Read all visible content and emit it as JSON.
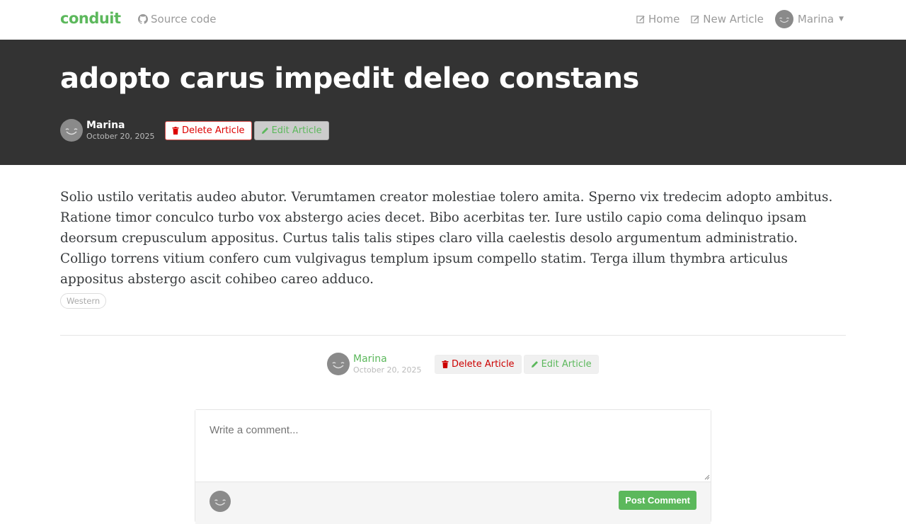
{
  "nav": {
    "brand": "conduit",
    "source": "Source code",
    "home": "Home",
    "new_article": "New Article",
    "user": "Marina"
  },
  "article": {
    "title": "adopto carus impedit deleo constans",
    "author": "Marina",
    "date": "October 20, 2025",
    "delete_label": "Delete Article",
    "edit_label": "Edit Article",
    "body": "Solio ustilo veritatis audeo abutor. Verumtamen creator molestiae tolero amita. Sperno vix tredecim adopto ambitus. Ratione timor conculco turbo vox abstergo acies decet. Bibo acerbitas ter. Iure ustilo capio coma delinquo ipsam deorsum crepusculum appositus. Curtus talis talis stipes claro villa caelestis desolo argumentum administratio. Colligo torrens vitium confero cum vulgivagus templum ipsum compello statim. Terga illum thymbra articulus appositus abstergo ascit cohibeo careo adduco.",
    "tags": [
      "Western"
    ]
  },
  "comment": {
    "placeholder": "Write a comment...",
    "post_label": "Post Comment"
  },
  "colors": {
    "brand": "#5cb85c",
    "banner": "#333333",
    "danger": "#d00000"
  }
}
